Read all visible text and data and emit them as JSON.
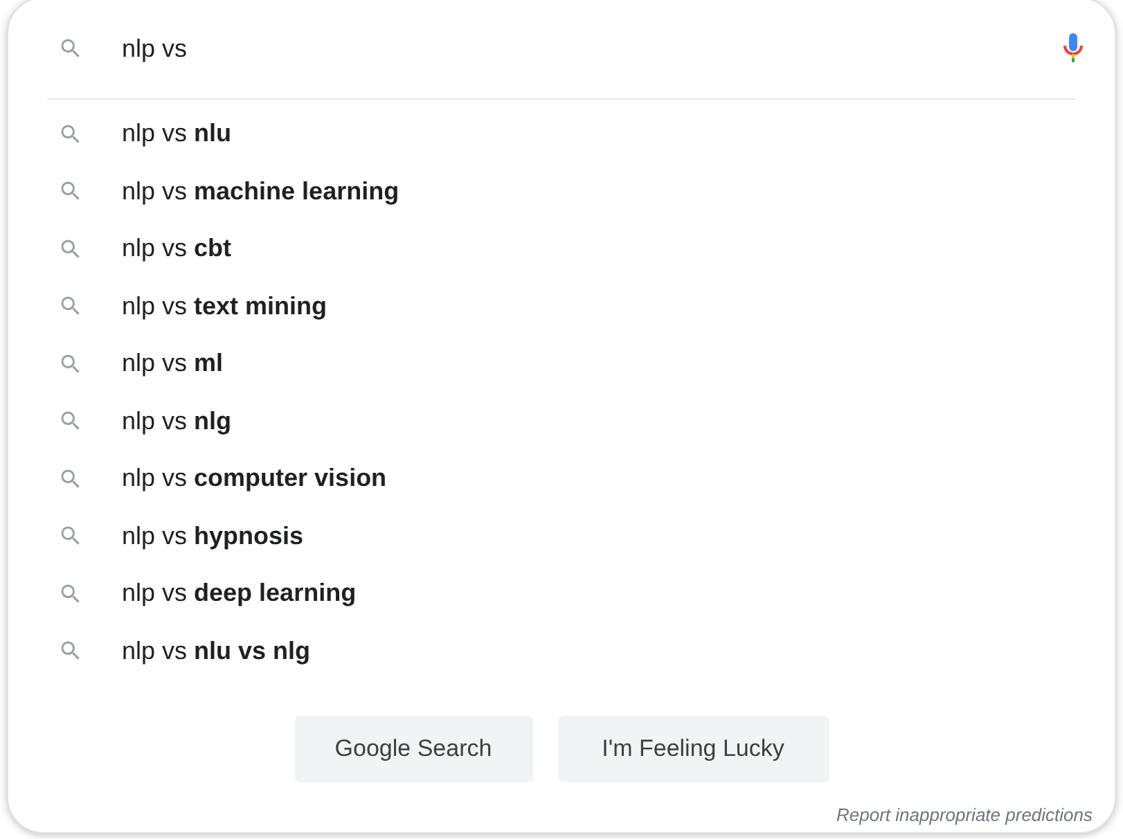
{
  "search": {
    "value": "nlp vs"
  },
  "suggestions": [
    {
      "text": "nlp vs **nlu**"
    },
    {
      "text": "nlp vs **machine learning**"
    },
    {
      "text": "nlp vs **cbt**"
    },
    {
      "text": "nlp vs **text mining**"
    },
    {
      "text": "nlp vs **ml**"
    },
    {
      "text": "nlp vs **nlg**"
    },
    {
      "text": "nlp vs **computer vision**"
    },
    {
      "text": "nlp vs **hypnosis**"
    },
    {
      "text": "nlp vs **deep learning**"
    },
    {
      "text": "nlp vs **nlu vs nlg**"
    }
  ],
  "buttons": [
    "Google Search",
    "I'm Feeling Lucky"
  ],
  "report_link": "Report inappropriate predictions"
}
